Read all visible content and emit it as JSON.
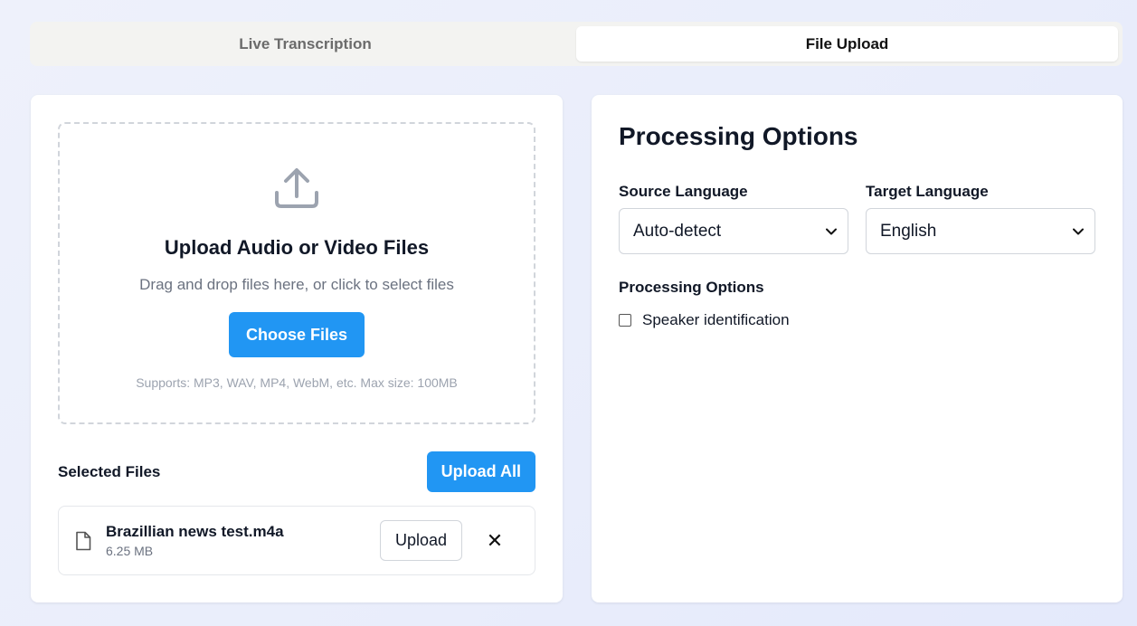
{
  "tabs": [
    {
      "label": "Live Transcription",
      "active": false
    },
    {
      "label": "File Upload",
      "active": true
    }
  ],
  "upload": {
    "title": "Upload Audio or Video Files",
    "subtitle": "Drag and drop files here, or click to select files",
    "choose_label": "Choose Files",
    "hint": "Supports: MP3, WAV, MP4, WebM, etc. Max size: 100MB",
    "icon": "upload-icon"
  },
  "selected": {
    "title": "Selected Files",
    "upload_all_label": "Upload All",
    "files": [
      {
        "name": "Brazillian news test.m4a",
        "size": "6.25 MB",
        "upload_label": "Upload",
        "remove_glyph": "✕"
      }
    ]
  },
  "processing": {
    "title": "Processing Options",
    "source_label": "Source Language",
    "source_value": "Auto-detect",
    "target_label": "Target Language",
    "target_value": "English",
    "options_label": "Processing Options",
    "speaker_id_label": "Speaker identification",
    "speaker_id_checked": false
  },
  "colors": {
    "accent": "#2196f3",
    "background": "#eef1fb"
  }
}
